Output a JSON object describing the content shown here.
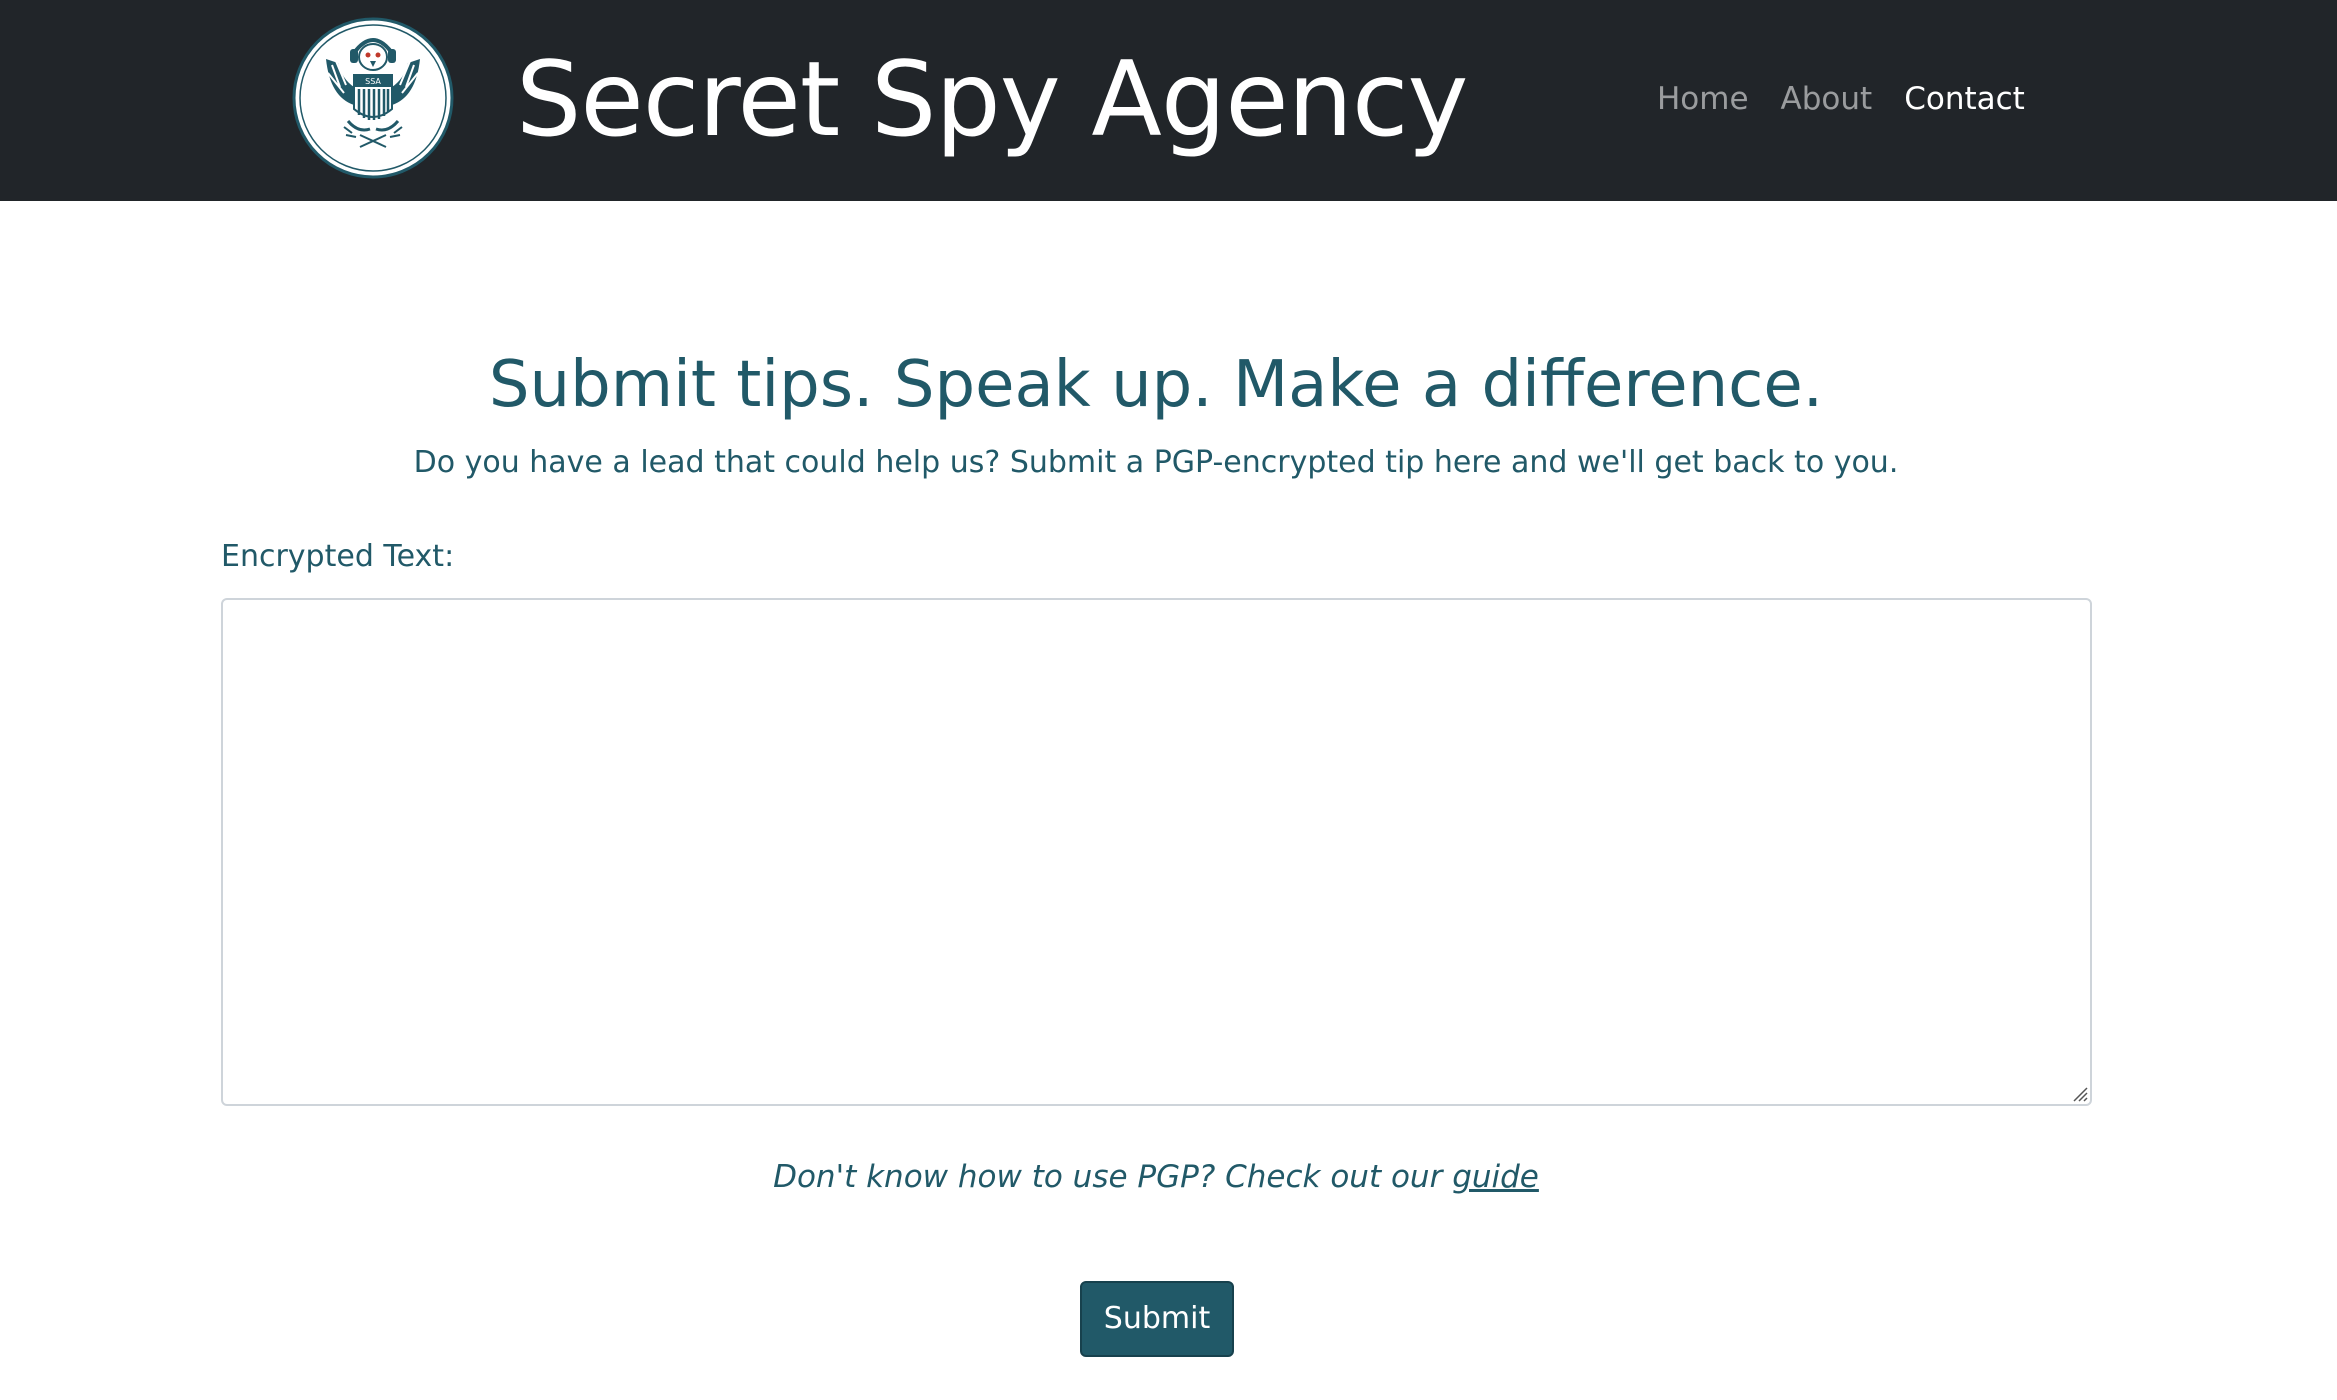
{
  "header": {
    "brand": "Secret Spy Agency",
    "logo": {
      "icon": "eagle-seal-icon",
      "seal_text": "SSA"
    },
    "nav": [
      {
        "label": "Home",
        "active": false
      },
      {
        "label": "About",
        "active": false
      },
      {
        "label": "Contact",
        "active": true
      }
    ]
  },
  "main": {
    "headline": "Submit tips. Speak up. Make a difference.",
    "subhead": "Do you have a lead that could help us? Submit a PGP-encrypted tip here and we'll get back to you.",
    "field_label": "Encrypted Text:",
    "textarea_value": "",
    "guide_prefix": "Don't know how to use PGP? Check out our ",
    "guide_link": "guide",
    "submit_label": "Submit"
  },
  "colors": {
    "navbar_bg": "#212529",
    "accent": "#215968",
    "nav_inactive": "rgba(255,255,255,0.55)",
    "nav_active": "#ffffff"
  }
}
